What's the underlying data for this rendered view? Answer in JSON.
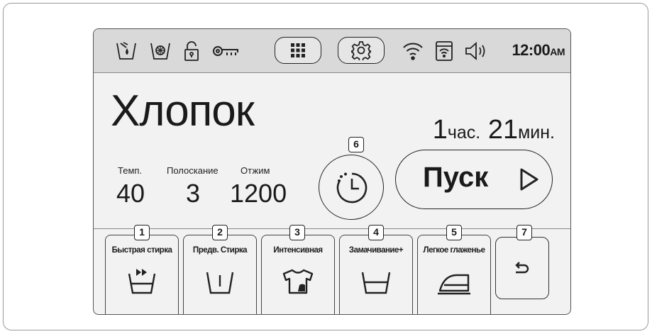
{
  "status_bar": {
    "icons": [
      "detergent-icon",
      "eco-bubble-icon",
      "door-unlocked-icon",
      "child-lock-key-icon",
      "menu-grid-icon",
      "settings-gear-icon",
      "wifi-icon",
      "smart-control-icon",
      "sound-icon"
    ],
    "time": "12:00",
    "ampm": "AM"
  },
  "program": {
    "name": "Хлопок",
    "remaining_hours": "1",
    "hours_unit": "час.",
    "remaining_minutes": "21",
    "minutes_unit": "мин."
  },
  "params": [
    {
      "label": "Темп.",
      "value": "40"
    },
    {
      "label": "Полоскание",
      "value": "3"
    },
    {
      "label": "Отжим",
      "value": "1200"
    }
  ],
  "start_button": {
    "label": "Пуск",
    "icon": "play-triangle-icon"
  },
  "delay_button": {
    "icon": "delay-end-timer-icon"
  },
  "options": [
    {
      "label": "Быстрая стирка",
      "icon": "quick-wash-icon"
    },
    {
      "label": "Предв. Стирка",
      "icon": "prewash-icon"
    },
    {
      "label": "Интенсивная",
      "icon": "intensive-shirt-icon"
    },
    {
      "label": "Замачивание+",
      "icon": "soak-tub-icon"
    },
    {
      "label": "Легкое глаженье",
      "icon": "easy-iron-icon"
    }
  ],
  "back_button": {
    "icon": "back-arrow-icon"
  },
  "callouts": [
    "1",
    "2",
    "3",
    "4",
    "5",
    "6",
    "7"
  ]
}
